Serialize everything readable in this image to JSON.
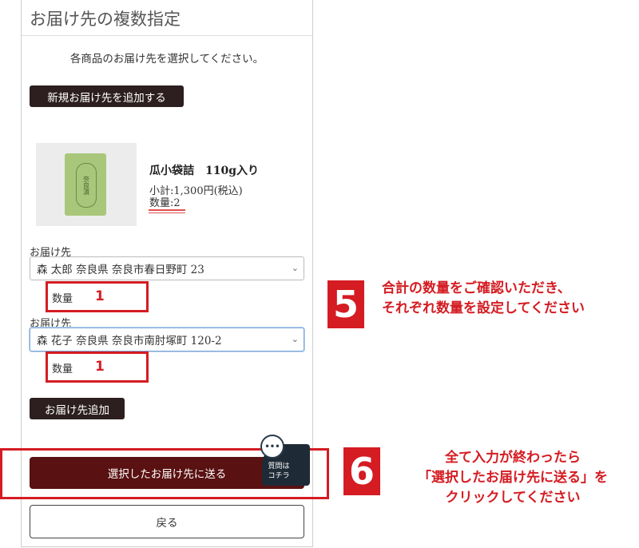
{
  "page": {
    "title": "お届け先の複数指定",
    "subtitle": "各商品のお届け先を選択してください。",
    "add_new_address_button": "新規お届け先を追加する"
  },
  "product": {
    "name": "瓜小袋詰　110g入り",
    "subtotal": "小計:1,300円(税込)",
    "quantity": "数量:2",
    "package_label": "奈良漬"
  },
  "deliveries": [
    {
      "label": "お届け先",
      "address": "森 太郎 奈良県 奈良市春日野町 23",
      "qty_label": "数量",
      "qty_value": "1"
    },
    {
      "label": "お届け先",
      "address": "森 花子 奈良県 奈良市南肘塚町 120-2",
      "qty_label": "数量",
      "qty_value": "1"
    }
  ],
  "add_delivery_button": "お届け先追加",
  "submit_button": "選択したお届け先に送る",
  "back_button": "戻る",
  "help_widget": {
    "text_line1": "質問は",
    "text_line2": "コチラ",
    "dots": "•••"
  },
  "annotations": [
    {
      "step": "5",
      "line1": "合計の数量をご確認いただき、",
      "line2": "それぞれ数量を設定してください"
    },
    {
      "step": "6",
      "line1": "全て入力が終わったら",
      "line2": "「選択したお届け先に送る」を",
      "line3": "クリックしてください"
    }
  ],
  "colors": {
    "annotation_red": "#d41c22",
    "primary_button": "#5a1111",
    "dark_button": "#2d1f1f"
  }
}
